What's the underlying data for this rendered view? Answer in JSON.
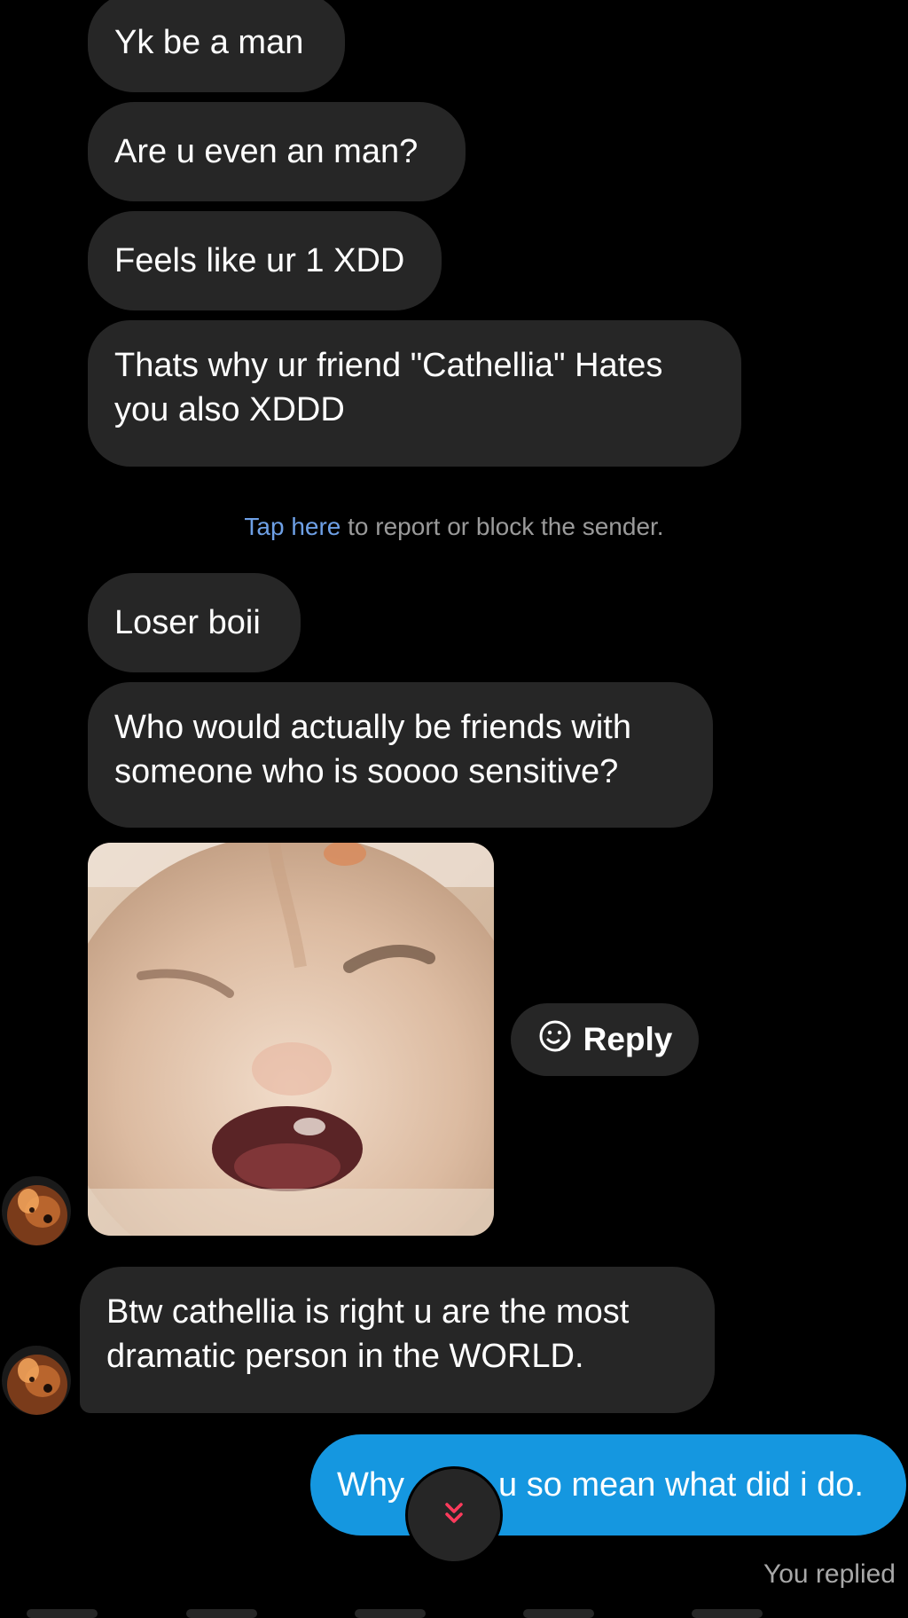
{
  "messages_incoming": [
    {
      "text": "Yk be a man"
    },
    {
      "text": "Are u even an man?"
    },
    {
      "text": "Feels like ur 1 XDD"
    },
    {
      "text": "Thats why ur friend \"Cathellia\" Hates you also XDDD"
    },
    {
      "text": "Loser boii"
    },
    {
      "text": "Who would actually be friends with someone who is soooo sensitive?"
    },
    {
      "text": "Btw cathellia is right u are the most dramatic person in the WORLD."
    }
  ],
  "safety_notice": {
    "link_text": "Tap here",
    "rest_text": " to report or block the sender."
  },
  "media_message": {
    "kind": "image",
    "subject": "cat-face-photo"
  },
  "reply_chip": {
    "label": "Reply",
    "icon": "sticker-smile-icon"
  },
  "outgoing_message": {
    "text_left": "Why",
    "text_right": "u so mean what did i do."
  },
  "scroll_to_bottom": {
    "icon": "double-chevron-down-icon",
    "color": "#ff3b5c"
  },
  "status": {
    "text": "You replied"
  },
  "colors": {
    "background": "#000000",
    "incoming_bubble": "#262626",
    "outgoing_bubble": "#1597e0",
    "link": "#6ea0e6"
  }
}
